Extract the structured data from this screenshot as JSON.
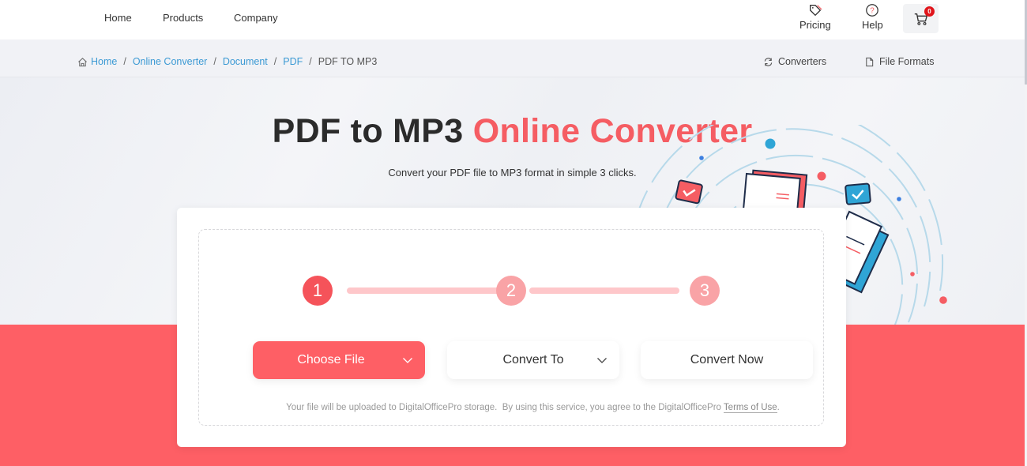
{
  "nav": {
    "links": [
      "Home",
      "Products",
      "Company"
    ],
    "pricing": {
      "label": "Pricing",
      "icon": "tag-icon"
    },
    "help": {
      "label": "Help",
      "icon": "help-circle-icon"
    },
    "cart": {
      "icon": "cart-icon",
      "count": "0"
    }
  },
  "breadcrumb": {
    "items": [
      "Home",
      "Online Converter",
      "Document",
      "PDF"
    ],
    "separator": "/",
    "current": "PDF TO MP3",
    "home_icon": "home-icon"
  },
  "tools": {
    "converters": {
      "label": "Converters",
      "icon": "refresh-icon"
    },
    "file_formats": {
      "label": "File Formats",
      "icon": "file-icon"
    }
  },
  "hero": {
    "title_main": "PDF to MP3 ",
    "title_accent": "Online Converter",
    "subtitle": "Convert your PDF file to MP3 format in simple 3 clicks."
  },
  "steps": {
    "items": [
      "1",
      "2",
      "3"
    ],
    "current": 1
  },
  "actions": {
    "choose_file": "Choose File",
    "convert_to": "Convert To",
    "convert_now": "Convert Now"
  },
  "terms": {
    "text": "Your file will be uploaded to DigitalOfficePro storage.  By using this service, you agree to the DigitalOfficePro ",
    "link": "Terms of Use",
    "end": "."
  },
  "colors": {
    "accent": "#fe5f65",
    "step_active": "#f5535a",
    "step_pending": "#f9a3a6",
    "link": "#3c9ad4",
    "badge": "#e0151b"
  }
}
